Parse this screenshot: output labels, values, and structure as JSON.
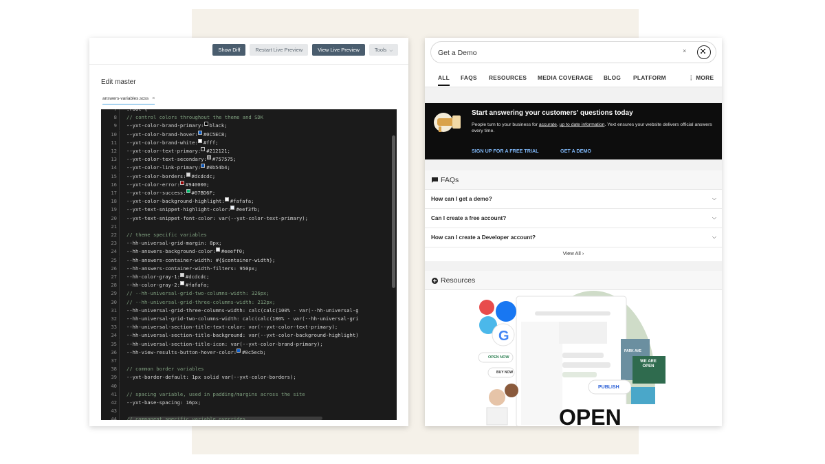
{
  "editor": {
    "toolbar": {
      "show_diff": "Show Diff",
      "restart_live_preview": "Restart Live Preview",
      "view_live_preview": "View Live Preview",
      "tools": "Tools"
    },
    "title": "Edit master",
    "file_tab": "answers-variables.scss",
    "code_lines": [
      {
        "n": "7",
        "t": ":root {",
        "style": "plain"
      },
      {
        "n": "8",
        "t": "// control colors throughout the theme and SDK",
        "style": "comment"
      },
      {
        "n": "9",
        "t": "--yxt-color-brand-primary: ",
        "v": "black;",
        "swatch": "#000000"
      },
      {
        "n": "10",
        "t": "--yxt-color-brand-hover: ",
        "v": "#0C5EC8;",
        "swatch": "#0C5EC8"
      },
      {
        "n": "11",
        "t": "--yxt-color-brand-white: ",
        "v": "#fff;",
        "swatch": "#ffffff"
      },
      {
        "n": "12",
        "t": "--yxt-color-text-primary: ",
        "v": "#212121;",
        "swatch": "#212121"
      },
      {
        "n": "13",
        "t": "--yxt-color-text-secondary: ",
        "v": "#757575;",
        "swatch": "#757575"
      },
      {
        "n": "14",
        "t": "--yxt-color-link-primary: ",
        "v": "#0b54b4;",
        "swatch": "#0b54b4"
      },
      {
        "n": "15",
        "t": "--yxt-color-borders: ",
        "v": "#dcdcdc;",
        "swatch": "#dcdcdc"
      },
      {
        "n": "16",
        "t": "--yxt-color-error: ",
        "v": "#940000;",
        "swatch": "#940000"
      },
      {
        "n": "17",
        "t": " --yxt-color-success: ",
        "v": "#07BD6F;",
        "swatch": "#07BD6F"
      },
      {
        "n": "18",
        "t": "--yxt-color-background-highlight: ",
        "v": "#fafafa;",
        "swatch": "#fafafa"
      },
      {
        "n": "19",
        "t": "--yxt-text-snippet-highlight-color: ",
        "v": "#eef3fb;",
        "swatch": "#eef3fb"
      },
      {
        "n": "20",
        "t": "--yxt-text-snippet-font-color: var(--yxt-color-text-primary);",
        "style": "plain"
      },
      {
        "n": "21",
        "t": "",
        "style": "plain"
      },
      {
        "n": "22",
        "t": "// theme specific variables",
        "style": "comment"
      },
      {
        "n": "23",
        "t": "--hh-universal-grid-margin: 8px;",
        "style": "plain"
      },
      {
        "n": "24",
        "t": "--hh-answers-background-color: ",
        "v": "#eeeff0;",
        "swatch": "#eeeff0"
      },
      {
        "n": "25",
        "t": "--hh-answers-container-width: #{$container-width};",
        "style": "plain"
      },
      {
        "n": "26",
        "t": "--hh-answers-container-width-filters: 950px;",
        "style": "plain"
      },
      {
        "n": "27",
        "t": "--hh-color-gray-1: ",
        "v": "#dcdcdc;",
        "swatch": "#dcdcdc"
      },
      {
        "n": "28",
        "t": "--hh-color-gray-2: ",
        "v": "#fafafa;",
        "swatch": "#fafafa"
      },
      {
        "n": "29",
        "t": "// --hh-universal-grid-two-columns-width: 326px;",
        "style": "comment"
      },
      {
        "n": "30",
        "t": "// --hh-universal-grid-three-columns-width: 212px;",
        "style": "comment"
      },
      {
        "n": "31",
        "t": "--hh-universal-grid-three-columns-width: calc(calc(100% - var(--hh-universal-g",
        "style": "plain"
      },
      {
        "n": "32",
        "t": "--hh-universal-grid-two-columns-width: calc(calc(100% - var(--hh-universal-gri",
        "style": "plain"
      },
      {
        "n": "33",
        "t": "--hh-universal-section-title-text-color: var(--yxt-color-text-primary);",
        "style": "plain"
      },
      {
        "n": "34",
        "t": "--hh-universal-section-title-background: var(--yxt-color-background-highlight)",
        "style": "plain"
      },
      {
        "n": "35",
        "t": "--hh-universal-section-title-icon: var(--yxt-color-brand-primary);",
        "style": "plain"
      },
      {
        "n": "36",
        "t": "--hh-view-results-button-hover-color: ",
        "v": "#0c5ecb;",
        "swatch": "#0c5ecb"
      },
      {
        "n": "37",
        "t": "",
        "style": "plain"
      },
      {
        "n": "38",
        "t": "// common border variables",
        "style": "comment"
      },
      {
        "n": "39",
        "t": "--yxt-border-default: 1px solid var(--yxt-color-borders);",
        "style": "plain"
      },
      {
        "n": "40",
        "t": "",
        "style": "plain"
      },
      {
        "n": "41",
        "t": "// spacing variable, used in padding/margins across the site",
        "style": "comment"
      },
      {
        "n": "42",
        "t": "--yxt-base-spacing: 16px;",
        "style": "plain"
      },
      {
        "n": "43",
        "t": "",
        "style": "plain"
      },
      {
        "n": "44",
        "t": "// component specific variable overrides",
        "style": "comment"
      }
    ]
  },
  "search": {
    "query": "Get a Demo",
    "placeholder": "Get a Demo",
    "clear_label": "×",
    "tabs": [
      {
        "label": "ALL",
        "active": true
      },
      {
        "label": "FAQS"
      },
      {
        "label": "RESOURCES"
      },
      {
        "label": "MEDIA COVERAGE"
      },
      {
        "label": "BLOG"
      },
      {
        "label": "PLATFORM"
      },
      {
        "label": "⋮ MORE"
      }
    ],
    "promo": {
      "title": "Start answering your customers' questions today",
      "body_prefix": "People turn to your business for ",
      "link1": "accurate",
      "body_mid": ", ",
      "link2": "up to date information",
      "body_suffix": ". Yext ensures your website delivers official answers every time.",
      "cta1": "SIGN UP FOR A FREE TRIAL",
      "cta2": "GET A DEMO"
    },
    "faqs": {
      "heading": "FAQs",
      "items": [
        "How can I get a demo?",
        "Can I create a free account?",
        "How can I create a Developer account?"
      ],
      "view_all": "View All"
    },
    "resources": {
      "heading": "Resources",
      "art_labels": {
        "open_now": "OPEN NOW",
        "buy_now": "BUY NOW",
        "publish": "PUBLISH",
        "park_ave": "PARK AVE",
        "sign": "WE ARE OPEN",
        "big_open": "OPEN"
      }
    }
  },
  "colors": {
    "backdrop": "#f5f1e9",
    "toolbar_dark": "#4a5d6e",
    "promo_link": "#7eb5f5",
    "code_bg": "#1b1b1b"
  }
}
